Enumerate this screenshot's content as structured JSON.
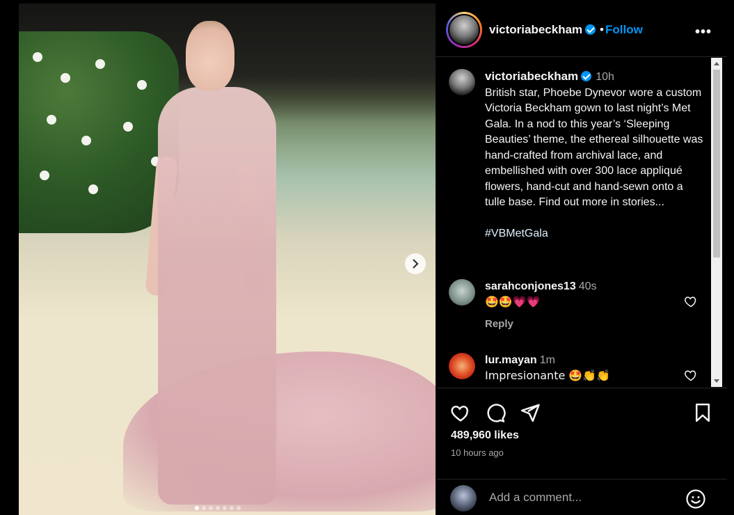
{
  "post": {
    "username": "victoriabeckham",
    "follow_label": "Follow",
    "separator": "•",
    "more_label": "•••",
    "caption_time": "10h",
    "caption": "British star, Phoebe Dynevor wore a custom Victoria Beckham gown to last night’s Met Gala. In a nod to this year’s ‘Sleeping Beauties’ theme, the ethereal silhouette was hand-crafted from archival lace, and embellished with over 300 lace appliqué flowers, hand-cut and hand-sewn onto a tulle base. Find out more in stories...",
    "hashtag": "#VBMetGala"
  },
  "comments": [
    {
      "user": "sarahconjones13",
      "time": "40s",
      "text": "🤩🤩💗💗",
      "reply": "Reply"
    },
    {
      "user": "lur.mayan",
      "time": "1m",
      "text": "Impresionante 🤩👏👏"
    }
  ],
  "stats": {
    "likes": "489,960 likes",
    "time_ago": "10 hours ago"
  },
  "composer": {
    "placeholder": "Add a comment..."
  },
  "carousel": {
    "count": 7,
    "active_index": 0
  },
  "colors": {
    "accent": "#0095f6",
    "background": "#000000",
    "muted": "#a8a8a8"
  },
  "icons": [
    "verified-icon",
    "heart-icon",
    "comment-icon",
    "share-icon",
    "bookmark-icon",
    "emoji-icon",
    "chevron-right-icon"
  ]
}
